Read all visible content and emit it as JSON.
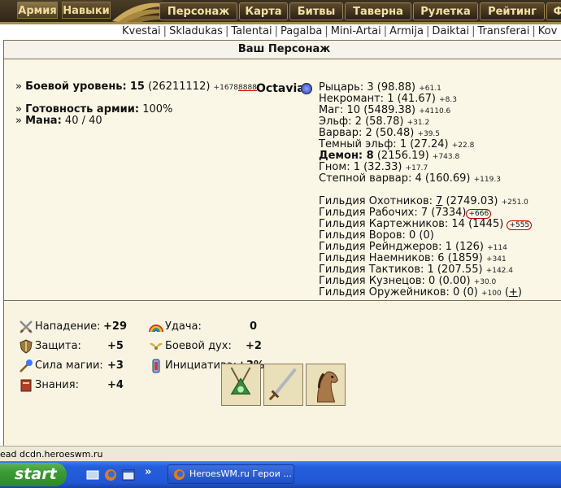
{
  "top_left_buttons": [
    "Армия",
    "Навыки"
  ],
  "tabs": [
    "Персонаж",
    "Карта",
    "Битвы",
    "Таверна",
    "Рулетка",
    "Рейтинг",
    "Ф"
  ],
  "subnav": [
    "Kvestai",
    "Skladukas",
    "Talentai",
    "Pagalba",
    "Mini-Artai",
    "Armija",
    "Daiktai",
    "Transferai",
    "Kov"
  ],
  "panel_title": "Ваш Персонаж",
  "character": {
    "nick": "Octavia"
  },
  "left_stats": {
    "combat_label": "Боевой уровень:",
    "combat_level": "15",
    "combat_exp": "(26211112)",
    "combat_next": "+1678",
    "combat_next_u": "8888",
    "army_label": "Готовность армии:",
    "army_value": "100%",
    "mana_label": "Мана:",
    "mana_value": "40 / 40",
    "bullet": "»"
  },
  "factions": [
    {
      "text": "Рыцарь: 3 (98.88)",
      "delta": "+61.1"
    },
    {
      "text": "Некромант: 1 (41.67)",
      "delta": "+8.3"
    },
    {
      "text": "Маг: 10 (5489.38)",
      "delta": "+4110.6"
    },
    {
      "text": "Эльф: 2 (58.78)",
      "delta": "+31.2"
    },
    {
      "text": "Варвар: 2 (50.48)",
      "delta": "+39.5"
    },
    {
      "text": "Темный эльф: 1 (27.24)",
      "delta": "+22.8"
    },
    {
      "bold": "Демон: 8",
      "text": " (2156.19)",
      "delta": "+743.8"
    },
    {
      "text": "Гном: 1 (32.33)",
      "delta": "+17.7"
    },
    {
      "text": "Степной варвар: 4 (160.69)",
      "delta": "+119.3"
    }
  ],
  "guilds": [
    {
      "pre": "Гильдия Охотников: ",
      "lvl": "7",
      "post": " (2749.03)",
      "delta": "+251.0"
    },
    {
      "pre": "Гильдия Рабочих: 7 (7334)",
      "lvl": "",
      "post": "",
      "delta": "+666",
      "circled": true
    },
    {
      "pre": "Гильдия Картежников: 14 (1445)",
      "lvl": "",
      "post": "",
      "delta": "+555",
      "circled": true
    },
    {
      "pre": "Гильдия Воров: 0 (0)",
      "lvl": "",
      "post": "",
      "delta": ""
    },
    {
      "pre": "Гильдия Рейнджеров: 1 (126)",
      "lvl": "",
      "post": "",
      "delta": "+114"
    },
    {
      "pre": "Гильдия Наемников: 6 (1859)",
      "lvl": "",
      "post": "",
      "delta": "+341"
    },
    {
      "pre": "Гильдия Тактиков: 1 (207.55)",
      "lvl": "",
      "post": "",
      "delta": "+142.4"
    },
    {
      "pre": "Гильдия Кузнецов: 0 (0.00)",
      "lvl": "",
      "post": "",
      "delta": "+30.0"
    },
    {
      "pre": "Гильдия Оружейников: 0 (0)",
      "lvl": "",
      "post": "",
      "delta": "+100"
    }
  ],
  "plus_link": "+",
  "attributes": {
    "attack_label": "Нападение:",
    "attack_value": "+29",
    "defense_label": "Защита:",
    "defense_value": "+5",
    "spell_label": "Сила магии:",
    "spell_value": "+3",
    "knowledge_label": "Знания:",
    "knowledge_value": "+4",
    "luck_label": "Удача:",
    "luck_value": "0",
    "morale_label": "Боевой дух:",
    "morale_value": "+2",
    "initiative_label": "Инициатива:",
    "initiative_value": "+3%"
  },
  "status_text": "ead dcdn.heroeswm.ru",
  "taskbar": {
    "start": "start",
    "task": "HeroesWM.ru Герои ...",
    "chevron": "»"
  },
  "colors": {
    "panel_bg": "#f9f4e2",
    "topbar": "#3b2f1e",
    "tab_text": "#f3e2a6",
    "taskbar": "#245edb"
  }
}
